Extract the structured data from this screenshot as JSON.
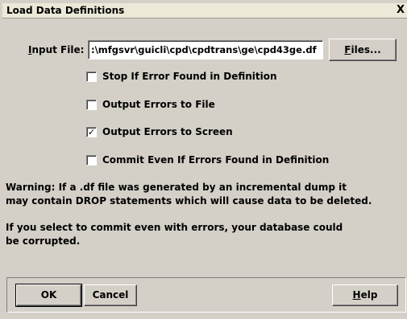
{
  "window": {
    "title": "Load Data Definitions",
    "close_glyph": "X"
  },
  "input_file": {
    "label_mnemonic": "I",
    "label_rest": "nput File:",
    "value": ":\\mfgsvr\\guicli\\cpd\\cpdtrans\\ge\\cpd43ge.df"
  },
  "files_button": {
    "mnemonic": "F",
    "rest": "iles..."
  },
  "options": [
    {
      "label": "Stop If Error Found in Definition",
      "checked": false
    },
    {
      "label": "Output Errors to File",
      "checked": false
    },
    {
      "label": "Output Errors to Screen",
      "checked": true
    },
    {
      "label": "Commit Even If Errors Found in Definition",
      "checked": false
    }
  ],
  "warning": {
    "line1": "Warning: If a .df file was generated by an incremental dump it",
    "line2": "may contain DROP statements which will cause data to be deleted."
  },
  "commit_note": {
    "line1": "If you select to commit even with errors, your database could",
    "line2": "be corrupted."
  },
  "buttons": {
    "ok": "OK",
    "cancel": "Cancel",
    "help_mnemonic": "H",
    "help_rest": "elp"
  }
}
